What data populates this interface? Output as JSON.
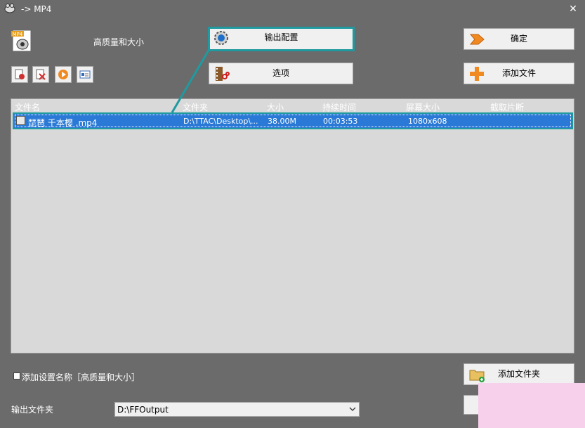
{
  "window": {
    "title": "-> MP4",
    "close_symbol": "✕"
  },
  "preset": {
    "label": "高质量和大小"
  },
  "buttons": {
    "output_config": "输出配置",
    "options": "选项",
    "ok": "确定",
    "add_file": "添加文件",
    "add_folder": "添加文件夹"
  },
  "columns": [
    "文件名",
    "文件夹",
    "大小",
    "持续时间",
    "屏幕大小",
    "截取片断"
  ],
  "files": [
    {
      "name": "琵琶 千本樱 .mp4",
      "folder": "D:\\TTAC\\Desktop\\...",
      "size": "38.00M",
      "duration": "00:03:53",
      "resolution": "1080x608",
      "clip": ""
    }
  ],
  "footer": {
    "add_setting_name_label": "添加设置名称［高质量和大小］",
    "add_setting_name_checked": false,
    "output_folder_label": "输出文件夹",
    "output_folder_value": "D:\\FFOutput"
  },
  "colors": {
    "selection": "#2a79d6",
    "highlight": "#1f9aa0",
    "background": "#6b6b6b"
  }
}
